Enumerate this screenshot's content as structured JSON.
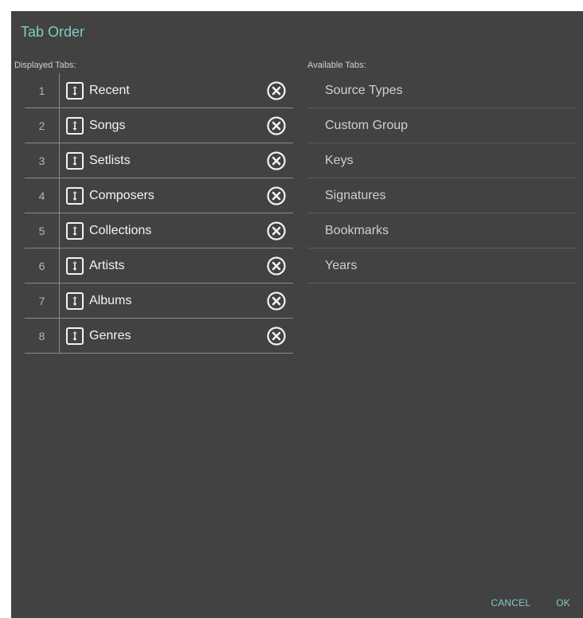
{
  "dialog": {
    "title": "Tab Order",
    "displayed_label": "Displayed Tabs:",
    "available_label": "Available Tabs:",
    "accent_color": "#80cbc4",
    "background_color": "#424242",
    "displayed_tabs": [
      {
        "index": "1",
        "label": "Recent"
      },
      {
        "index": "2",
        "label": "Songs"
      },
      {
        "index": "3",
        "label": "Setlists"
      },
      {
        "index": "4",
        "label": "Composers"
      },
      {
        "index": "5",
        "label": "Collections"
      },
      {
        "index": "6",
        "label": "Artists"
      },
      {
        "index": "7",
        "label": "Albums"
      },
      {
        "index": "8",
        "label": "Genres"
      }
    ],
    "available_tabs": [
      {
        "label": "Source Types"
      },
      {
        "label": "Custom Group"
      },
      {
        "label": "Keys"
      },
      {
        "label": "Signatures"
      },
      {
        "label": "Bookmarks"
      },
      {
        "label": "Years"
      }
    ],
    "icons": {
      "drag_handle": "drag-handle-icon",
      "remove": "remove-circle-x-icon"
    },
    "cancel_label": "CANCEL",
    "ok_label": "OK"
  }
}
